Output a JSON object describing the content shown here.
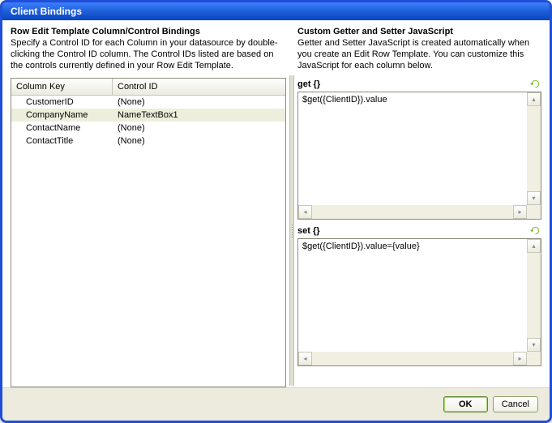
{
  "window": {
    "title": "Client Bindings"
  },
  "left": {
    "heading": "Row Edit Template Column/Control Bindings",
    "description": "Specify a Control ID for each Column in your datasource by double-clicking the Control ID column. The Control IDs listed are based on the controls currently defined in your Row Edit Template.",
    "columns": {
      "key": "Column Key",
      "control": "Control ID"
    },
    "rows": [
      {
        "key": "CustomerID",
        "control": "(None)"
      },
      {
        "key": "CompanyName",
        "control": "NameTextBox1"
      },
      {
        "key": "ContactName",
        "control": "(None)"
      },
      {
        "key": "ContactTitle",
        "control": "(None)"
      }
    ],
    "selectedIndex": 1
  },
  "right": {
    "heading": "Custom Getter and Setter JavaScript",
    "description": "Getter and Setter JavaScript is created automatically when you create an Edit Row Template. You can customize this JavaScript for each column below.",
    "getLabel": "get {}",
    "getCode": "$get({ClientID}).value",
    "setLabel": "set {}",
    "setCode": "$get({ClientID}).value={value}"
  },
  "buttons": {
    "ok": "OK",
    "cancel": "Cancel"
  }
}
